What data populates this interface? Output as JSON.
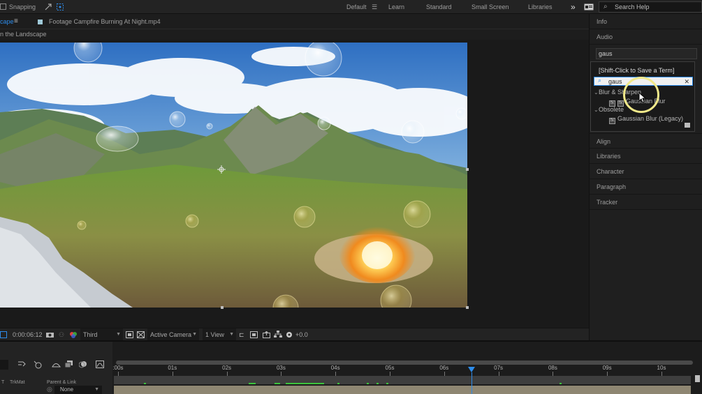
{
  "toolbar": {
    "snapping_label": "Snapping",
    "workspaces": [
      "Default",
      "Learn",
      "Standard",
      "Small Screen",
      "Libraries"
    ],
    "active_workspace": "Default",
    "overflow_label": "»",
    "search_help_label": "Search Help"
  },
  "composition": {
    "tab_label": "cape",
    "footage_tab_label": "Footage  Campfire Burning At Night.mp4",
    "breadcrumb": "n the Landscape"
  },
  "viewer_footer": {
    "timecode": "0:00:06:12",
    "resolution": "Third",
    "camera": "Active Camera",
    "view_layout": "1 View",
    "exposure": "+0.0"
  },
  "timeline": {
    "time_labels": [
      ":00s",
      "01s",
      "02s",
      "03s",
      "04s",
      "05s",
      "06s",
      "07s",
      "08s",
      "09s",
      "10s"
    ],
    "current_time_seconds": 6.5,
    "col_t": "T",
    "col_trkmat": "TrkMat",
    "col_parent": "Parent & Link",
    "parent_value": "None"
  },
  "panels": {
    "items_top": [
      "Info",
      "Audio"
    ],
    "effects_search_value": "gaus",
    "items_bottom": [
      "Align",
      "Libraries",
      "Character",
      "Paragraph",
      "Tracker"
    ]
  },
  "effects_popup": {
    "hint": "[Shift-Click to Save a Term]",
    "search_value": "gaus",
    "groups": [
      {
        "name": "Blur & Sharpen",
        "items": [
          "Gaussian Blur"
        ]
      },
      {
        "name": "Obsolete",
        "items": [
          "Gaussian Blur (Legacy)"
        ]
      }
    ]
  },
  "colors": {
    "accent": "#2d8ceb",
    "panel_bg": "#1f1f1f",
    "cursor_highlight": "#f1e98a"
  }
}
